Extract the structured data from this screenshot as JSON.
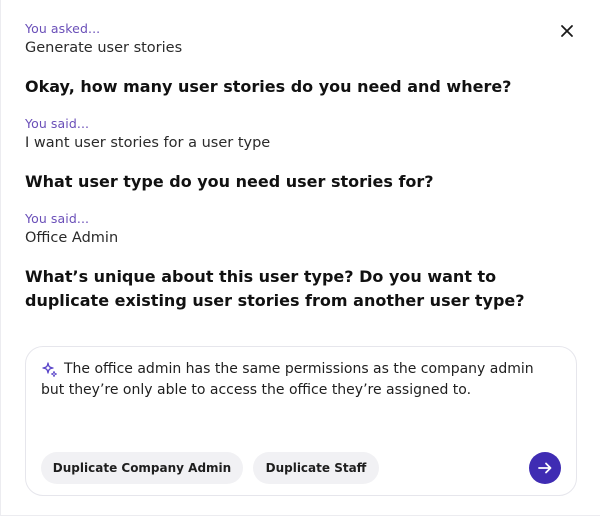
{
  "conversation": {
    "first": {
      "label": "You asked...",
      "text": "Generate user stories"
    },
    "question_1": "Okay, how many user stories do you need and where?",
    "reply_1": {
      "label": "You said...",
      "text": "I want user stories for a user type"
    },
    "question_2": "What user type do you need user stories for?",
    "reply_2": {
      "label": "You said...",
      "text": "Office Admin"
    },
    "question_3": "What’s unique about this user type? Do you want to duplicate existing user stories from another user type?"
  },
  "composer": {
    "icon": "sparkle-icon",
    "text": "The office admin has the same permissions as the company admin but they’re only able to access the office they’re assigned to.",
    "suggestions": [
      "Duplicate Company Admin",
      "Duplicate Staff"
    ],
    "send_icon": "arrow-right-icon"
  },
  "header": {
    "close_icon": "close-icon"
  },
  "colors": {
    "accent": "#3f2cb3",
    "label": "#6a4fb8",
    "chip_bg": "#f1f1f4",
    "border": "#e6e6ec"
  }
}
